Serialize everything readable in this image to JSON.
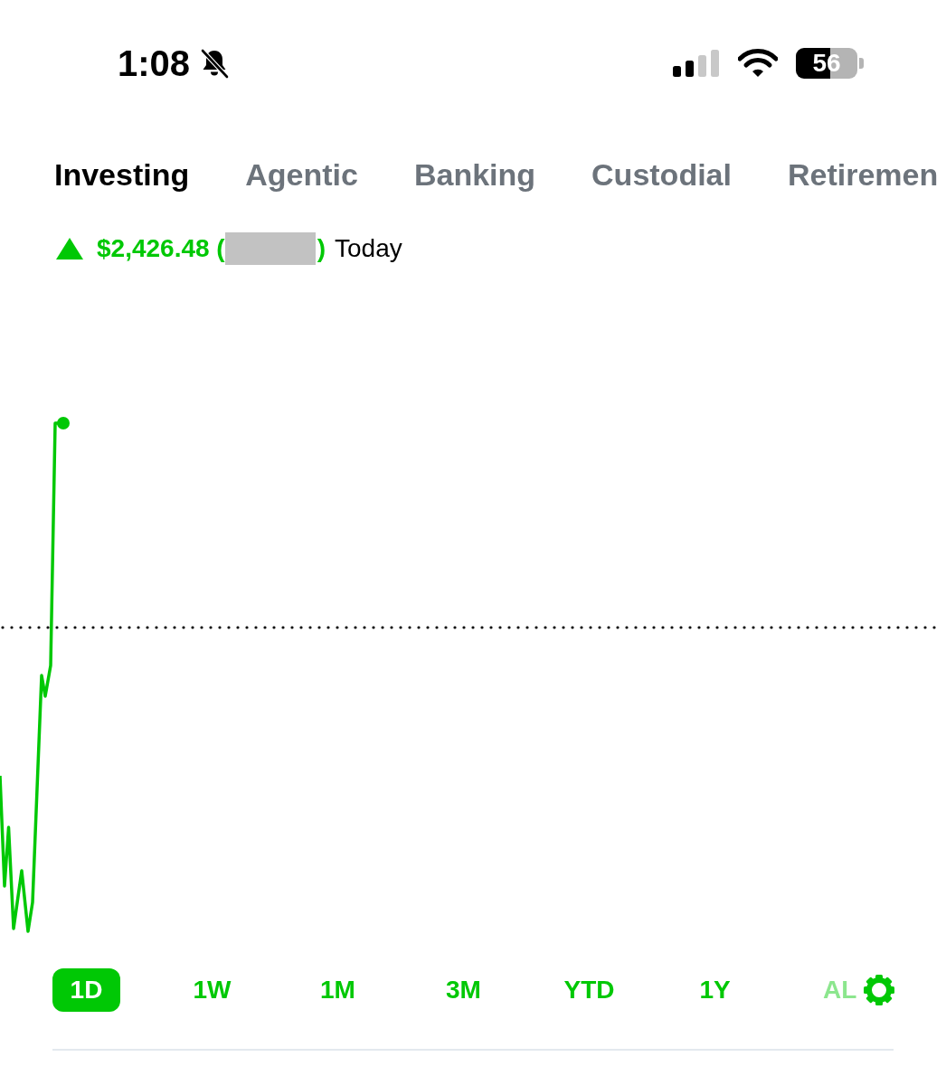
{
  "status_bar": {
    "time": "1:08",
    "silent": true,
    "battery": "56"
  },
  "account_tabs": [
    {
      "label": "Investing",
      "selected": true
    },
    {
      "label": "Agentic",
      "selected": false
    },
    {
      "label": "Banking",
      "selected": false
    },
    {
      "label": "Custodial",
      "selected": false
    },
    {
      "label": "Retiremen",
      "selected": false
    }
  ],
  "change": {
    "rising": true,
    "amount": "$2,426.48 (",
    "redacted": true,
    "close": ")",
    "period": "Today"
  },
  "range_tabs": [
    {
      "label": "1D",
      "selected": true,
      "faded": false
    },
    {
      "label": "1W",
      "selected": false,
      "faded": false
    },
    {
      "label": "1M",
      "selected": false,
      "faded": false
    },
    {
      "label": "3M",
      "selected": false,
      "faded": false
    },
    {
      "label": "YTD",
      "selected": false,
      "faded": false
    },
    {
      "label": "1Y",
      "selected": false,
      "faded": false
    },
    {
      "label": "AL",
      "selected": false,
      "faded": true
    }
  ]
}
